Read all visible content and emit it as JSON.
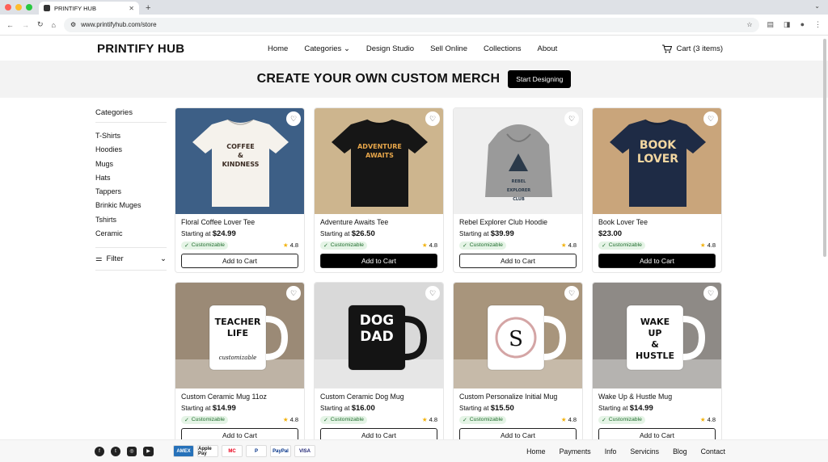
{
  "browser": {
    "tab_title": "PRINTIFY HUB",
    "new_tab_glyph": "+",
    "url": "www.printifyhub.com/store",
    "icons": [
      "back-icon",
      "forward-icon",
      "reload-icon",
      "home-icon",
      "site-info-icon",
      "star-icon",
      "extensions-icon",
      "sidebar-icon",
      "profile-icon",
      "menu-icon"
    ]
  },
  "header": {
    "brand": "PRINTIFY HUB",
    "nav": [
      "Home",
      "Categories",
      "Design Studio",
      "Sell Online",
      "Collections",
      "About"
    ],
    "cart": "Cart (3 items)"
  },
  "banner": {
    "title": "CREATE YOUR OWN CUSTOM MERCH",
    "button": "Start Designing"
  },
  "sidebar": {
    "title": "Categories",
    "categories": [
      "T-Shirts",
      "Hoodies",
      "Mugs",
      "Hats",
      "Tappers",
      "Brinkic Muges",
      "Tshirts",
      "Ceramic"
    ],
    "filter": "Filter"
  },
  "products": [
    {
      "name": "Floral Coffee Lover Tee",
      "prefix": "Starting at ",
      "price": "$24.99",
      "badge": "Customizable",
      "rating": "4.8",
      "button": "Add to Cart",
      "art": "COFFEE & KINDNESS",
      "shirt": "#f5f2ec",
      "ink": "#3a2b22",
      "bg": "#3d5f86"
    },
    {
      "name": "Adventure Awaits Tee",
      "prefix": "Starting at ",
      "price": "$26.50",
      "badge": "Customizable",
      "rating": "4.8",
      "button": "Add to Cart",
      "art": "ADVENTURE AWAITS",
      "shirt": "#161616",
      "ink": "#e7a64a",
      "bg": "#cdb58e"
    },
    {
      "name": "Rebel Explorer Club Hoodie",
      "prefix": "Starting at ",
      "price": "$39.99",
      "badge": "Customizable",
      "rating": "4.8",
      "button": "Add to Cart",
      "art": "REBEL EXPLORER CLUB",
      "shirt": "#9a9a9a",
      "ink": "#2b3a4a",
      "bg": "#efefef"
    },
    {
      "name": "Book Lover Tee",
      "prefix": "",
      "price": "$23.00",
      "badge": "Customizable",
      "rating": "4.8",
      "button": "Add to Cart",
      "art": "BOOK LOVER",
      "shirt": "#1e2b45",
      "ink": "#f3d7a1",
      "bg": "#c9a57b"
    },
    {
      "name": "Custom Ceramic Mug 11oz",
      "prefix": "Starting at ",
      "price": "$14.99",
      "badge": "Customizable",
      "rating": "4.8",
      "button": "Add to Cart",
      "art": "TEACHER LIFE",
      "art2": "customizable",
      "mug": "#ffffff",
      "ink": "#111111",
      "bg": "#9b8a76"
    },
    {
      "name": "Custom Ceramic Dog Mug",
      "prefix": "Starting at ",
      "price": "$16.00",
      "badge": "Customizable",
      "rating": "4.8",
      "button": "Add to Cart",
      "art": "DOG DAD",
      "mug": "#141414",
      "ink": "#ffffff",
      "bg": "#d9d9d9"
    },
    {
      "name": "Custom Personalize Initial Mug",
      "prefix": "Starting at ",
      "price": "$15.50",
      "badge": "Customizable",
      "rating": "4.8",
      "button": "Add to Cart",
      "art": "S",
      "mug": "#ffffff",
      "ink": "#111111",
      "bg": "#a8957c"
    },
    {
      "name": "Wake Up & Hustle Mug",
      "prefix": "Starting at ",
      "price": "$14.99",
      "badge": "Customizable",
      "rating": "4.8",
      "button": "Add to Cart",
      "art": "WAKE UP & HUSTLE",
      "mug": "#ffffff",
      "ink": "#111111",
      "bg": "#8e8a86"
    }
  ],
  "footer": {
    "social": [
      "facebook-icon",
      "twitter-icon",
      "instagram-icon",
      "youtube-icon"
    ],
    "payments": [
      "AMEX",
      "Apple Pay",
      "MC",
      "P",
      "PayPal",
      "VISA"
    ],
    "links": [
      "Home",
      "Payments",
      "Info",
      "Servicins",
      "Blog",
      "Contact"
    ]
  },
  "colors": {
    "accent": "#000000",
    "badge_bg": "#e5f4e6",
    "badge_text": "#1f6d2d",
    "star": "#f2b20c"
  }
}
